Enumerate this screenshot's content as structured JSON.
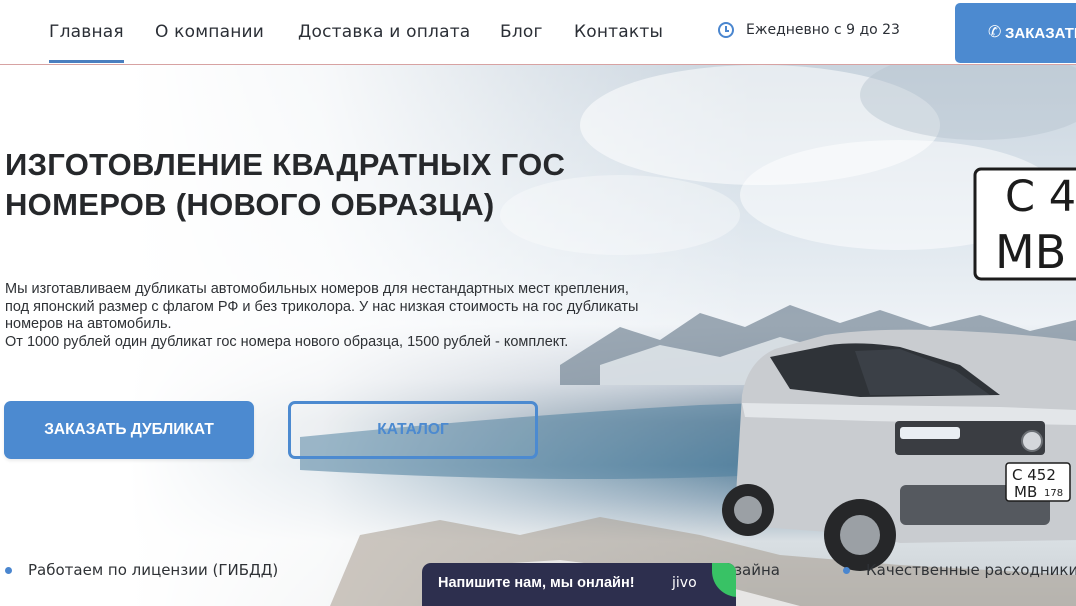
{
  "header": {
    "nav": [
      {
        "label": "Главная",
        "active": true
      },
      {
        "label": "О компании",
        "active": false
      },
      {
        "label": "Доставка и оплата",
        "active": false
      },
      {
        "label": "Блог",
        "active": false
      },
      {
        "label": "Контакты",
        "active": false
      }
    ],
    "hours": "Ежедневно с 9 до 23",
    "order_button": "ЗАКАЗАТЬ"
  },
  "hero": {
    "title_line1": "ИЗГОТОВЛЕНИЕ КВАДРАТНЫХ ГОС",
    "title_line2": "НОМЕРОВ (НОВОГО ОБРАЗЦА)",
    "description": [
      "Мы изготавливаем дубликаты автомобильных номеров для нестандартных мест крепления,",
      "под японский размер с флагом РФ и без триколора. У нас низкая стоимость на гос дубликаты",
      "номеров на автомобиль.",
      "От 1000 рублей один дубликат гос номера нового образца, 1500 рублей - комплект."
    ],
    "primary_button": "ЗАКАЗАТЬ ДУБЛИКАТ",
    "secondary_button": "КАТАЛОГ",
    "plate_big": {
      "line1": "С 4",
      "line2": "МВ"
    },
    "plate_car": {
      "line1": "С 452",
      "line2": "МВ",
      "region": "178"
    }
  },
  "features": [
    "Работаем по лицензии (ГИБДД)",
    "о дизайна",
    "Качественные расходники"
  ],
  "chat": {
    "message": "Напишите нам, мы онлайн!",
    "brand": "jivo"
  },
  "colors": {
    "accent": "#4c8ad0",
    "chat_bg": "#2d2f4e",
    "chat_leaf": "#38c265"
  }
}
